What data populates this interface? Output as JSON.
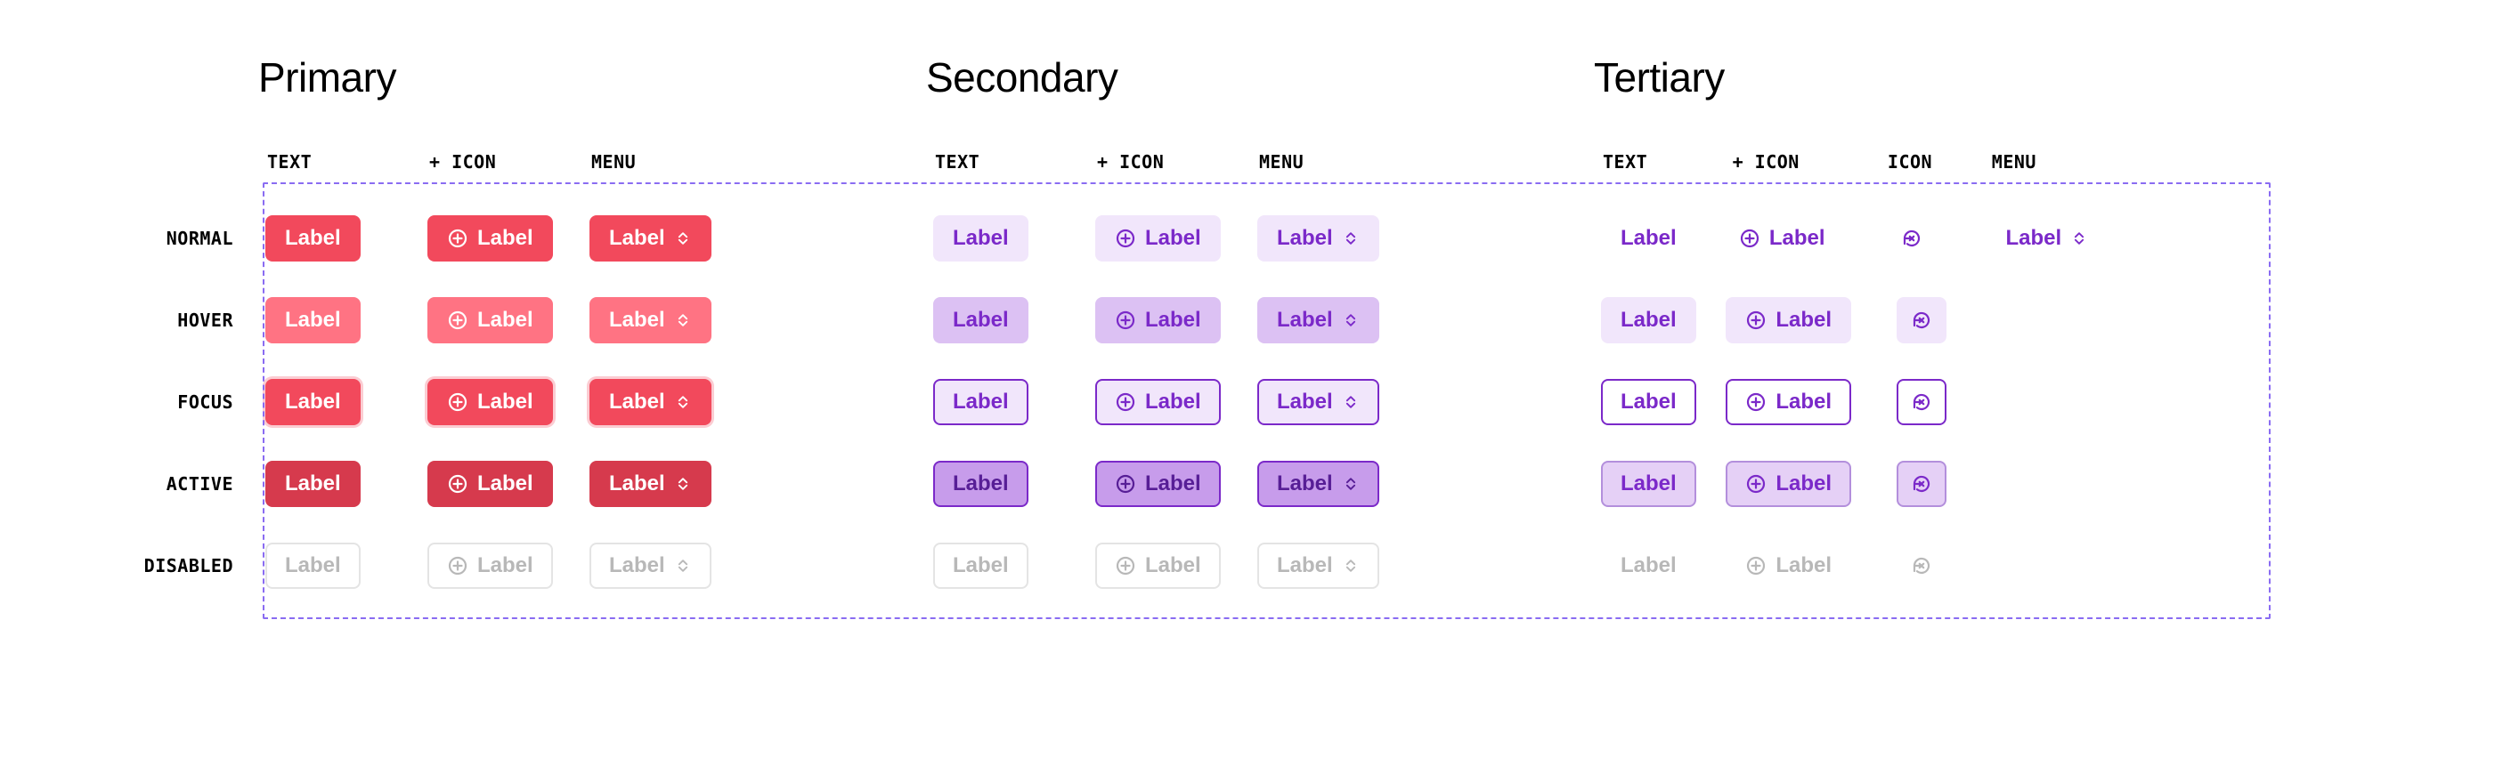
{
  "sections": [
    {
      "key": "primary",
      "title": "Primary",
      "variants": [
        "text",
        "icon",
        "menu"
      ]
    },
    {
      "key": "secondary",
      "title": "Secondary",
      "variants": [
        "text",
        "icon",
        "menu"
      ]
    },
    {
      "key": "tertiary",
      "title": "Tertiary",
      "variants": [
        "text",
        "icon",
        "icononly",
        "menu"
      ]
    }
  ],
  "columnHeads": {
    "text": "TEXT",
    "icon": "+ ICON",
    "icononly": "ICON",
    "menu": "MENU"
  },
  "states": [
    {
      "key": "normal",
      "label": "NORMAL"
    },
    {
      "key": "hover",
      "label": "HOVER"
    },
    {
      "key": "focus",
      "label": "FOCUS"
    },
    {
      "key": "active",
      "label": "ACTIVE"
    },
    {
      "key": "disabled",
      "label": "DISABLED"
    }
  ],
  "label": "Label",
  "tertiaryMenuStates": [
    "normal"
  ],
  "colors": {
    "primary": "#f2495c",
    "secondary": "#7b29c9",
    "frame": "#8a6cf2"
  }
}
